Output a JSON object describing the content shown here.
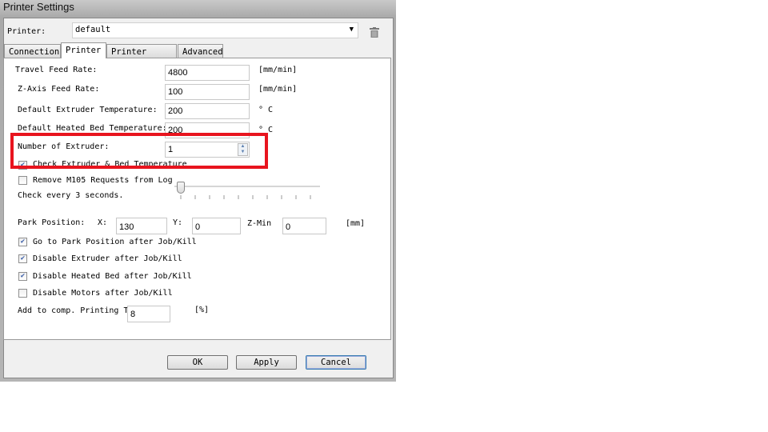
{
  "window": {
    "title": "Printer Settings"
  },
  "printer": {
    "label": "Printer:",
    "value": "default"
  },
  "tabs": [
    {
      "label": "Connection"
    },
    {
      "label": "Printer"
    },
    {
      "label": "Printer Shape"
    },
    {
      "label": "Advanced"
    }
  ],
  "fields": {
    "travel_feed": {
      "label": "Travel Feed Rate:",
      "value": "4800",
      "unit": "[mm/min]"
    },
    "z_feed": {
      "label": "Z-Axis Feed Rate:",
      "value": "100",
      "unit": "[mm/min]"
    },
    "extruder_temp": {
      "label": "Default Extruder Temperature:",
      "value": "200",
      "unit": "° C"
    },
    "bed_temp": {
      "label": "Default Heated Bed Temperature:",
      "value": "200",
      "unit": "° C"
    },
    "num_extruder": {
      "label": "Number of Extruder:",
      "value": "1"
    }
  },
  "check_temp": {
    "label": "Check Extruder & Bed Temperature",
    "checked": true
  },
  "remove_m105": {
    "label": "Remove M105 Requests from Log",
    "checked": false
  },
  "check_every": {
    "label": "Check every 3 seconds.",
    "slider_value": 3
  },
  "park": {
    "label": "Park Position:",
    "x_label": "X:",
    "x": "130",
    "y_label": "Y:",
    "y": "0",
    "z_label": "Z-Min",
    "z": "0",
    "unit": "[mm]"
  },
  "options": [
    {
      "label": "Go to Park Position after Job/Kill",
      "checked": true
    },
    {
      "label": "Disable Extruder after Job/Kill",
      "checked": true
    },
    {
      "label": "Disable Heated Bed after Job/Kill",
      "checked": true
    },
    {
      "label": "Disable Motors after Job/Kill",
      "checked": false
    }
  ],
  "comp": {
    "label": "Add to comp. Printing T",
    "value": "8",
    "unit": "[%]"
  },
  "buttons": {
    "ok": "OK",
    "apply": "Apply",
    "cancel": "Cancel"
  },
  "highlight_color": "#e8141e"
}
